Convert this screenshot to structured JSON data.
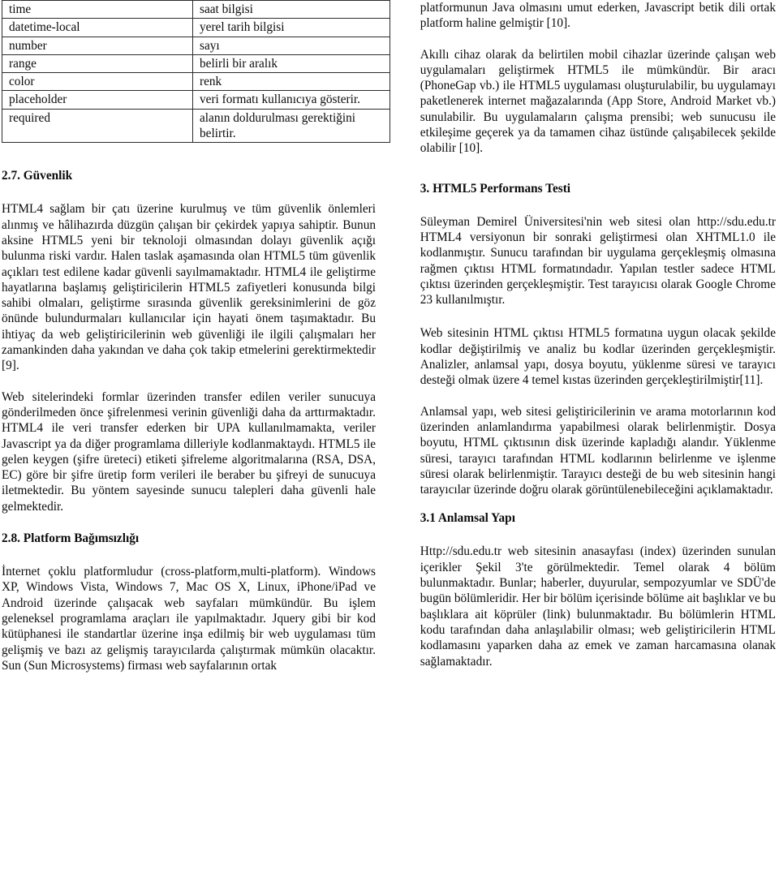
{
  "document": {
    "language": "Turkish",
    "layout": "two-column academic paper page"
  },
  "table": {
    "name": "html5-input-attributes-table",
    "rows": [
      {
        "attribute": "time",
        "description": "saat bilgisi"
      },
      {
        "attribute": "datetime-local",
        "description": "yerel tarih bilgisi"
      },
      {
        "attribute": "number",
        "description": "sayı"
      },
      {
        "attribute": "range",
        "description": "belirli bir aralık"
      },
      {
        "attribute": "color",
        "description": "renk"
      },
      {
        "attribute": "placeholder",
        "description": "veri formatı kullanıcıya gösterir."
      },
      {
        "attribute": "required",
        "description": "alanın doldurulması gerektiğini belirtir."
      }
    ]
  },
  "left_column": {
    "heading_2_7": "2.7. Güvenlik",
    "para_guvenlik_1": "HTML4 sağlam bir çatı üzerine kurulmuş ve tüm güvenlik önlemleri alınmış ve hâlihazırda düzgün çalışan bir çekirdek yapıya sahiptir. Bunun aksine HTML5 yeni bir teknoloji olmasından dolayı güvenlik açığı bulunma riski vardır. Halen taslak aşamasında olan HTML5 tüm güvenlik açıkları test edilene kadar güvenli sayılmamaktadır. HTML4 ile geliştirme hayatlarına başlamış geliştiricilerin HTML5 zafiyetleri konusunda bilgi sahibi olmaları, geliştirme sırasında güvenlik gereksinimlerini de göz önünde bulundurmaları kullanıcılar için hayati önem taşımaktadır.  Bu ihtiyaç da web geliştiricilerinin web güvenliği ile ilgili çalışmaları her zamankinden daha yakından ve daha çok takip etmelerini gerektirmektedir [9].",
    "para_guvenlik_2": "Web sitelerindeki formlar üzerinden transfer edilen veriler sunucuya gönderilmeden önce şifrelenmesi verinin güvenliği daha da arttırmaktadır. HTML4 ile veri transfer ederken bir UPA kullanılmamakta, veriler Javascript ya da diğer programlama dilleriyle kodlanmaktaydı. HTML5 ile gelen keygen (şifre üreteci) etiketi şifreleme algoritmalarına (RSA, DSA, EC) göre bir şifre üretip form verileri ile beraber bu şifreyi de sunucuya iletmektedir. Bu yöntem sayesinde sunucu talepleri daha güvenli hale gelmektedir.",
    "heading_2_8": "2.8. Platform Bağımsızlığı",
    "para_platform_1": "İnternet çoklu platformludur (cross-platform,multi-platform). Windows XP, Windows Vista, Windows 7, Mac OS X, Linux, iPhone/iPad ve Android üzerinde çalışacak web sayfaları mümkündür. Bu işlem geleneksel programlama araçları ile yapılmaktadır. Jquery gibi bir kod kütüphanesi ile standartlar üzerine inşa edilmiş bir web uygulaması tüm gelişmiş ve bazı az gelişmiş tarayıcılarda çalıştırmak mümkün olacaktır. Sun (Sun Microsystems) firması web sayfalarının ortak"
  },
  "right_column": {
    "para_platform_cont": "platformunun Java olmasını umut ederken, Javascript betik dili ortak platform haline gelmiştir [10].",
    "para_akilli_cihaz": "Akıllı cihaz olarak da belirtilen mobil cihazlar üzerinde çalışan web uygulamaları geliştirmek HTML5 ile mümkündür. Bir aracı (PhoneGap vb.) ile HTML5 uygulaması oluşturulabilir, bu uygulamayı paketlenerek internet mağazalarında (App Store, Android Market vb.) sunulabilir. Bu uygulamaların çalışma prensibi; web sunucusu ile etkileşime geçerek ya da tamamen cihaz üstünde çalışabilecek şekilde olabilir [10].",
    "heading_3": "3. HTML5 Performans Testi",
    "para_test_1": "Süleyman Demirel Üniversitesi'nin web sitesi olan http://sdu.edu.tr HTML4 versiyonun bir sonraki geliştirmesi olan XHTML1.0 ile kodlanmıştır. Sunucu tarafından bir uygulama gerçekleşmiş olmasına rağmen çıktısı HTML formatındadır. Yapılan testler sadece HTML çıktısı üzerinden gerçekleşmiştir. Test tarayıcısı olarak Google Chrome 23 kullanılmıştır.",
    "para_test_2": "Web sitesinin HTML çıktısı HTML5 formatına uygun olacak şekilde kodlar değiştirilmiş ve analiz bu kodlar üzerinden gerçekleşmiştir. Analizler, anlamsal yapı, dosya boyutu, yüklenme süresi ve tarayıcı desteği olmak üzere 4 temel kıstas üzerinden gerçekleştirilmiştir[11].",
    "para_test_3": "Anlamsal yapı, web sitesi geliştiricilerinin ve arama motorlarının kod üzerinden anlamlandırma yapabilmesi olarak belirlenmiştir. Dosya boyutu, HTML çıktısının disk üzerinde kapladığı alandır. Yüklenme süresi, tarayıcı tarafından HTML kodlarının belirlenme ve işlenme süresi olarak belirlenmiştir. Tarayıcı desteği de bu web sitesinin hangi tarayıcılar üzerinde doğru olarak görüntülenebileceğini açıklamaktadır.",
    "heading_3_1": "3.1 Anlamsal Yapı",
    "para_anlamsal": "Http://sdu.edu.tr web sitesinin anasayfası (index) üzerinden sunulan içerikler Şekil 3'te görülmektedir. Temel olarak 4 bölüm bulunmaktadır. Bunlar; haberler, duyurular, sempozyumlar ve SDÜ'de bugün bölümleridir. Her bir bölüm içerisinde bölüme ait başlıklar ve bu başlıklara ait köprüler (link) bulunmaktadır. Bu bölümlerin HTML kodu tarafından daha anlaşılabilir olması; web geliştiricilerin HTML kodlamasını yaparken daha az emek ve zaman harcamasına olanak sağlamaktadır."
  }
}
